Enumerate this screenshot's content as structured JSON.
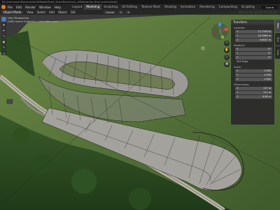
{
  "titlebar": {
    "text": "[D:\\Users\\user\\Documents\\3DModel\\Track_Scan\\Racetrack_v3\\Racetrack_final_scene.blend]"
  },
  "menu": {
    "items": [
      "File",
      "Edit",
      "Render",
      "Window",
      "Help"
    ]
  },
  "workspaces": {
    "tabs": [
      "Layout",
      "Modeling",
      "Sculpting",
      "UV Editing",
      "Texture Paint",
      "Shading",
      "Animation",
      "Rendering",
      "Compositing",
      "Scripting"
    ],
    "active": "Modeling"
  },
  "scene": {
    "name": "Scene"
  },
  "viewport_header": {
    "mode": "Object Mode",
    "items": [
      "View",
      "Select",
      "Add",
      "Object",
      "GIS"
    ],
    "orientation": "Global",
    "pivot": "⊙",
    "snap": "⌖"
  },
  "overlay": {
    "perspective": "User Perspective",
    "collection": "(283) Scene Collection | sketchfab_track"
  },
  "toolbar": {
    "tools": [
      "↖",
      "✥",
      "⟳",
      "⤡",
      "▣",
      "✎",
      "◿"
    ]
  },
  "nav": {
    "buttons": [
      "+",
      "✋",
      "🎥",
      "▦"
    ]
  },
  "npanel": {
    "header": "Transform",
    "location_label": "Location:",
    "location": [
      [
        "X",
        "11.7158 m"
      ],
      [
        "Y",
        "24.3366 m"
      ],
      [
        "Z",
        "0.8437 m"
      ]
    ],
    "rotation_label": "Rotation:",
    "rotation": [
      [
        "X",
        "0°"
      ],
      [
        "Y",
        "0°"
      ],
      [
        "Z",
        "0°"
      ]
    ],
    "rotation_mode": "XYZ Euler",
    "scale_label": "Scale:",
    "scale": [
      [
        "X",
        "1.000"
      ],
      [
        "Y",
        "1.000"
      ],
      [
        "Z",
        "1.000"
      ]
    ],
    "dimensions_label": "Dimensions:",
    "dimensions": [
      [
        "X",
        "117 m"
      ],
      [
        "Y",
        "111 m"
      ],
      [
        "Z",
        "8.88 m"
      ]
    ]
  },
  "ntabs": [
    "Item",
    "Tool",
    "View"
  ],
  "colors": {
    "accent": "#e87d0d",
    "active_tool": "#4772b3",
    "grass": "#5f7a3a",
    "mesh": "#1a1a1a",
    "track": "#9a9a98"
  }
}
